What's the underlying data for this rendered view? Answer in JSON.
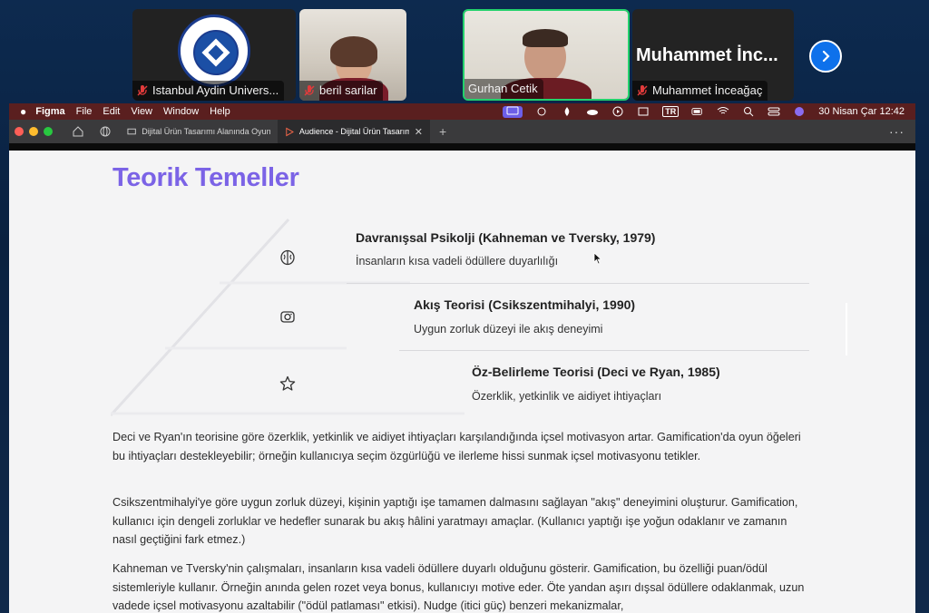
{
  "zoom": {
    "participants": [
      {
        "name": "Istanbul Aydin Univers...",
        "muted": true
      },
      {
        "name": "beril sarilar",
        "muted": true
      },
      {
        "name": "Gurhan Cetik",
        "muted": false,
        "active_speaker": true
      },
      {
        "name": "Muhammet İnceağaç",
        "muted": true,
        "display_name": "Muhammet İnc..."
      }
    ],
    "next_icon": "chevron-right-icon",
    "active_color": "#23d16c"
  },
  "menubar": {
    "app": "Figma",
    "items": [
      "File",
      "Edit",
      "View",
      "Window",
      "Help"
    ],
    "input_badge": "TR",
    "datetime": "30 Nisan Çar  12:42"
  },
  "browser": {
    "tabs": [
      {
        "label": "Dijital Ürün Tasarımı Alanında Oyunla:",
        "active": false
      },
      {
        "label": "Audience - Dijital Ürün Tasarımı A",
        "active": true
      }
    ],
    "new_tab": "+",
    "more": "···"
  },
  "slide": {
    "title": "Teorik Temeller",
    "accent_color": "#7b63e6",
    "rows": [
      {
        "icon": "brain-icon",
        "title": "Davranışsal  Psikolji  (Kahneman ve Tversky, 1979)",
        "subtitle": "İnsanların kısa vadeli ödüllere duyarlılığı"
      },
      {
        "icon": "camera-icon",
        "title": "Akış Teorisi (Csikszentmihalyi, 1990)",
        "subtitle": "Uygun zorluk düzeyi ile akış deneyimi"
      },
      {
        "icon": "star-icon",
        "title": "Öz-Belirleme Teorisi (Deci ve Ryan, 1985)",
        "subtitle": "Özerklik, yetkinlik ve aidiyet ihtiyaçları"
      }
    ],
    "paragraphs": [
      "Deci ve Ryan'ın teorisine göre özerklik, yetkinlik ve aidiyet ihtiyaçları karşılandığında içsel motivasyon artar. Gamification'da oyun öğeleri bu ihtiyaçları destekleyebilir; örneğin kullanıcıya seçim özgürlüğü ve ilerleme hissi sunmak içsel motivasyonu tetikler.",
      "Csikszentmihalyi'ye göre uygun zorluk düzeyi, kişinin yaptığı işe tamamen dalmasını sağlayan \"akış\" deneyimini oluşturur. Gamification, kullanıcı için dengeli zorluklar ve hedefler sunarak bu akış hâlini yaratmayı amaçlar. (Kullanıcı yaptığı işe yoğun odaklanır ve zamanın nasıl geçtiğini fark etmez.)",
      "Kahneman ve Tversky'nin çalışmaları, insanların kısa vadeli ödüllere duyarlı olduğunu gösterir. Gamification, bu özelliği puan/ödül sistemleriyle kullanır. Örneğin anında gelen rozet veya bonus, kullanıcıyı motive eder. Öte yandan aşırı dışsal ödüllere odaklanmak, uzun vadede içsel motivasyonu azaltabilir (\"ödül patlaması\" etkisi). Nudge (itici güç) benzeri mekanizmalar,"
    ]
  }
}
